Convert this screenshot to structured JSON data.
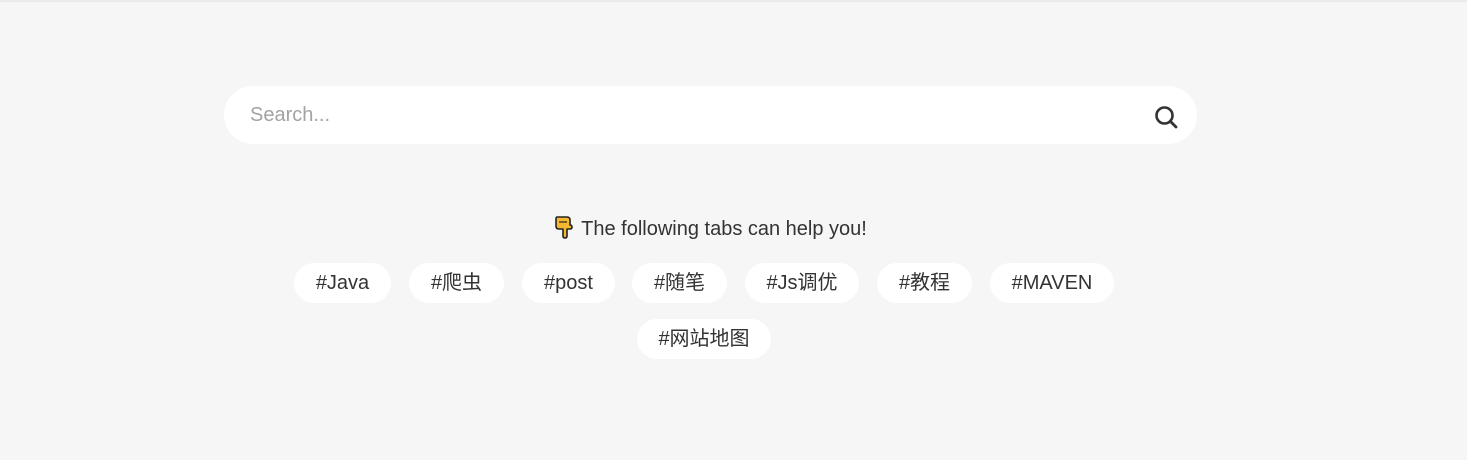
{
  "search": {
    "placeholder": "Search...",
    "value": "",
    "icon": "search-icon"
  },
  "hint": {
    "icon": "pointing-down-hand-icon",
    "text": "The following tabs can help you!"
  },
  "tags": [
    {
      "label": "#Java"
    },
    {
      "label": "#爬虫"
    },
    {
      "label": "#post"
    },
    {
      "label": "#随笔"
    },
    {
      "label": "#Js调优"
    },
    {
      "label": "#教程"
    },
    {
      "label": "#MAVEN"
    },
    {
      "label": "#网站地图"
    }
  ],
  "colors": {
    "background": "#f6f6f6",
    "surface": "#ffffff",
    "text": "#333333",
    "placeholder": "#a3a3a3",
    "hand_icon": "#f5b82e"
  }
}
